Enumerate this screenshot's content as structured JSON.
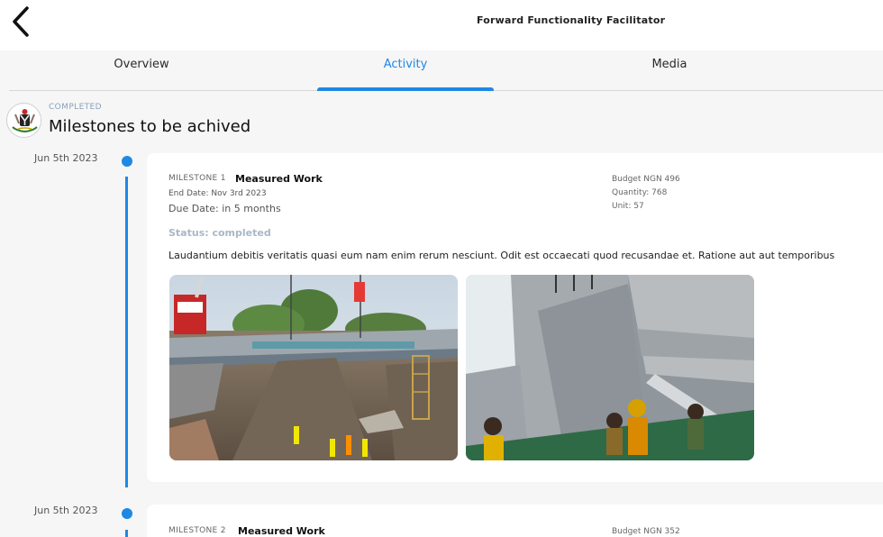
{
  "header": {
    "title": "Forward Functionality Facilitator",
    "back_icon": "chevron-left-icon"
  },
  "tabs": [
    {
      "label": "Overview",
      "active": false
    },
    {
      "label": "Activity",
      "active": true
    },
    {
      "label": "Media",
      "active": false
    }
  ],
  "accent_color": "#1e88e5",
  "project": {
    "status": "COMPLETED",
    "title": "Milestones to be achived",
    "emblem_icon": "coat-of-arms-icon"
  },
  "milestones": [
    {
      "date": "Jun 5th 2023",
      "label": "MILESTONE 1",
      "title": "Measured Work",
      "end_date_label": "End Date:",
      "end_date": "Nov 3rd 2023",
      "due_label": "Due Date:",
      "due": "in 5 months",
      "budget": "Budget NGN 496",
      "quantity": "Quantity: 768",
      "unit": "Unit: 57",
      "status": "Status: completed",
      "description": "Laudantium debitis veritatis quasi eum nam enim rerum nesciunt. Odit est occaecati quod recusandae et. Ratione aut aut temporibus",
      "photos": [
        "bridge-construction-photo",
        "concrete-workers-photo"
      ]
    },
    {
      "date": "Jun 5th 2023",
      "label": "MILESTONE 2",
      "title": "Measured Work",
      "budget": "Budget NGN 352"
    }
  ]
}
